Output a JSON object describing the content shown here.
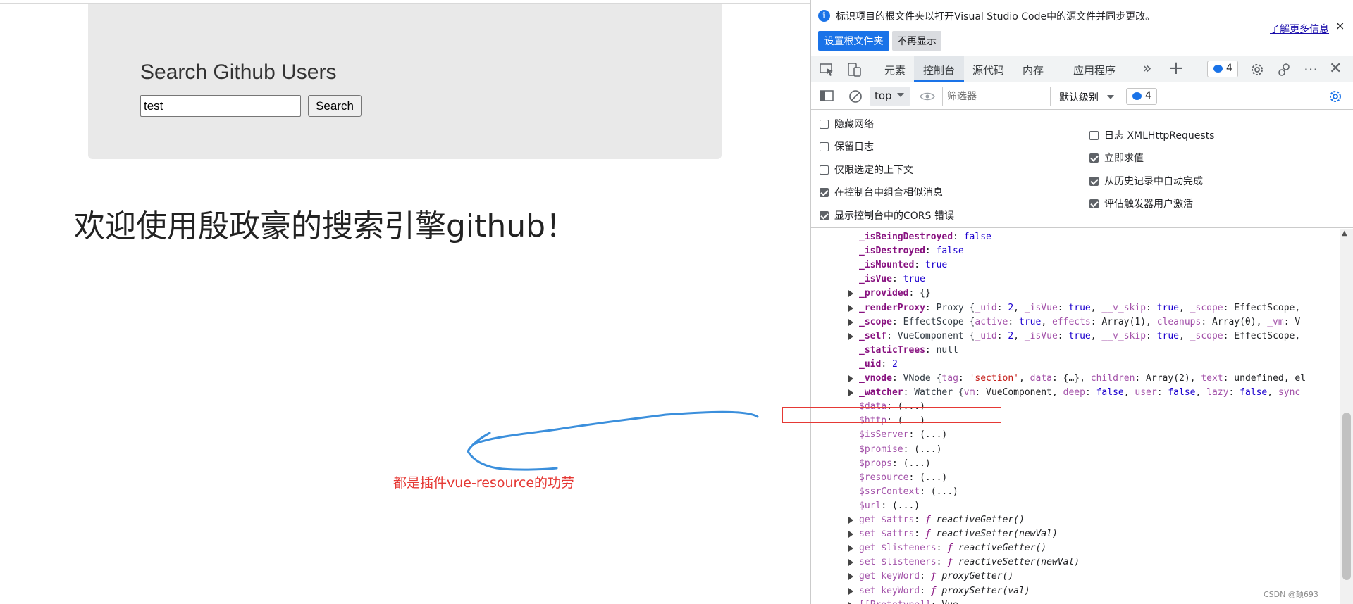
{
  "page": {
    "jumbotron_title": "Search Github Users",
    "search_value": "test",
    "search_button": "Search",
    "welcome": "欢迎使用殷政豪的搜索引擎github！",
    "annotation_note": "都是插件vue-resource的功劳"
  },
  "devtools": {
    "infobar": {
      "message": "标识项目的根文件夹以打开Visual Studio Code中的源文件并同步更改。",
      "learn_more": "了解更多信息",
      "close": "×",
      "set_root_button": "设置根文件夹",
      "dont_show_button": "不再显示"
    },
    "tabs": {
      "elements": "元素",
      "console": "控制台",
      "sources": "源代码",
      "memory": "内存",
      "application": "应用程序",
      "more": "»",
      "add": "+"
    },
    "issues_badge": "4",
    "filterbar": {
      "context": "top",
      "filter_placeholder": "筛选器",
      "level": "默认级别",
      "messages_badge": "4"
    },
    "settings": {
      "left": [
        {
          "label": "隐藏网络",
          "checked": false
        },
        {
          "label": "保留日志",
          "checked": false
        },
        {
          "label": "仅限选定的上下文",
          "checked": false
        },
        {
          "label": "在控制台中组合相似消息",
          "checked": true
        },
        {
          "label": "显示控制台中的CORS 错误",
          "checked": true
        }
      ],
      "right": [
        {
          "label": "日志 XMLHttpRequests",
          "checked": false
        },
        {
          "label": "立即求值",
          "checked": true
        },
        {
          "label": "从历史记录中自动完成",
          "checked": true
        },
        {
          "label": "评估触发器用户激活",
          "checked": true
        }
      ]
    },
    "console_lines": [
      {
        "expand": false,
        "key": "_isBeingDestroyed",
        "style": "kb",
        "rest": [
          [
            "pun",
            ": "
          ],
          [
            "n",
            "false"
          ]
        ]
      },
      {
        "expand": false,
        "key": "_isDestroyed",
        "style": "kb",
        "rest": [
          [
            "pun",
            ": "
          ],
          [
            "n",
            "false"
          ]
        ]
      },
      {
        "expand": false,
        "key": "_isMounted",
        "style": "kb",
        "rest": [
          [
            "pun",
            ": "
          ],
          [
            "n",
            "true"
          ]
        ]
      },
      {
        "expand": false,
        "key": "_isVue",
        "style": "kb",
        "rest": [
          [
            "pun",
            ": "
          ],
          [
            "n",
            "true"
          ]
        ]
      },
      {
        "expand": true,
        "key": "_provided",
        "style": "kb",
        "rest": [
          [
            "pun",
            ": {}"
          ]
        ]
      },
      {
        "expand": true,
        "key": "_renderProxy",
        "style": "kb",
        "rest": [
          [
            "pun",
            ": "
          ],
          [
            "cls",
            "Proxy {"
          ],
          [
            "kd",
            "_uid"
          ],
          [
            "pun",
            ": "
          ],
          [
            "n",
            "2"
          ],
          [
            "pun",
            ", "
          ],
          [
            "kd",
            "_isVue"
          ],
          [
            "pun",
            ": "
          ],
          [
            "n",
            "true"
          ],
          [
            "pun",
            ", "
          ],
          [
            "kd",
            "__v_skip"
          ],
          [
            "pun",
            ": "
          ],
          [
            "n",
            "true"
          ],
          [
            "pun",
            ", "
          ],
          [
            "kd",
            "_scope"
          ],
          [
            "pun",
            ": EffectScope, "
          ]
        ]
      },
      {
        "expand": true,
        "key": "_scope",
        "style": "kb",
        "rest": [
          [
            "pun",
            ": "
          ],
          [
            "cls",
            "EffectScope {"
          ],
          [
            "kd",
            "active"
          ],
          [
            "pun",
            ": "
          ],
          [
            "n",
            "true"
          ],
          [
            "pun",
            ", "
          ],
          [
            "kd",
            "effects"
          ],
          [
            "pun",
            ": Array(1), "
          ],
          [
            "kd",
            "cleanups"
          ],
          [
            "pun",
            ": Array(0), "
          ],
          [
            "kd",
            "_vm"
          ],
          [
            "pun",
            ": V"
          ]
        ]
      },
      {
        "expand": true,
        "key": "_self",
        "style": "kb",
        "rest": [
          [
            "pun",
            ": "
          ],
          [
            "cls",
            "VueComponent {"
          ],
          [
            "kd",
            "_uid"
          ],
          [
            "pun",
            ": "
          ],
          [
            "n",
            "2"
          ],
          [
            "pun",
            ", "
          ],
          [
            "kd",
            "_isVue"
          ],
          [
            "pun",
            ": "
          ],
          [
            "n",
            "true"
          ],
          [
            "pun",
            ", "
          ],
          [
            "kd",
            "__v_skip"
          ],
          [
            "pun",
            ": "
          ],
          [
            "n",
            "true"
          ],
          [
            "pun",
            ", "
          ],
          [
            "kd",
            "_scope"
          ],
          [
            "pun",
            ": EffectScope, "
          ]
        ]
      },
      {
        "expand": false,
        "key": "_staticTrees",
        "style": "kb",
        "rest": [
          [
            "pun",
            ": "
          ],
          [
            "cls",
            "null"
          ]
        ]
      },
      {
        "expand": false,
        "key": "_uid",
        "style": "kb",
        "rest": [
          [
            "pun",
            ": "
          ],
          [
            "n",
            "2"
          ]
        ]
      },
      {
        "expand": true,
        "key": "_vnode",
        "style": "kb",
        "rest": [
          [
            "pun",
            ": "
          ],
          [
            "cls",
            "VNode {"
          ],
          [
            "kd",
            "tag"
          ],
          [
            "pun",
            ": "
          ],
          [
            "s",
            "'section'"
          ],
          [
            "pun",
            ", "
          ],
          [
            "kd",
            "data"
          ],
          [
            "pun",
            ": {…}, "
          ],
          [
            "kd",
            "children"
          ],
          [
            "pun",
            ": Array(2), "
          ],
          [
            "kd",
            "text"
          ],
          [
            "pun",
            ": undefined, el"
          ]
        ]
      },
      {
        "expand": true,
        "key": "_watcher",
        "style": "kb",
        "rest": [
          [
            "pun",
            ": "
          ],
          [
            "cls",
            "Watcher {"
          ],
          [
            "kd",
            "vm"
          ],
          [
            "pun",
            ": VueComponent, "
          ],
          [
            "kd",
            "deep"
          ],
          [
            "pun",
            ": "
          ],
          [
            "n",
            "false"
          ],
          [
            "pun",
            ", "
          ],
          [
            "kd",
            "user"
          ],
          [
            "pun",
            ": "
          ],
          [
            "n",
            "false"
          ],
          [
            "pun",
            ", "
          ],
          [
            "kd",
            "lazy"
          ],
          [
            "pun",
            ": "
          ],
          [
            "n",
            "false"
          ],
          [
            "pun",
            ", "
          ],
          [
            "kd",
            "sync"
          ]
        ]
      },
      {
        "expand": false,
        "key": "$data",
        "style": "kd",
        "rest": [
          [
            "pun",
            ": (...)"
          ]
        ]
      },
      {
        "expand": false,
        "key": "$http",
        "style": "kd",
        "rest": [
          [
            "pun",
            ": (...)"
          ]
        ]
      },
      {
        "expand": false,
        "key": "$isServer",
        "style": "kd",
        "rest": [
          [
            "pun",
            ": (...)"
          ]
        ]
      },
      {
        "expand": false,
        "key": "$promise",
        "style": "kd",
        "rest": [
          [
            "pun",
            ": (...)"
          ]
        ]
      },
      {
        "expand": false,
        "key": "$props",
        "style": "kd",
        "rest": [
          [
            "pun",
            ": (...)"
          ]
        ]
      },
      {
        "expand": false,
        "key": "$resource",
        "style": "kd",
        "rest": [
          [
            "pun",
            ": (...)"
          ]
        ]
      },
      {
        "expand": false,
        "key": "$ssrContext",
        "style": "kd",
        "rest": [
          [
            "pun",
            ": (...)"
          ]
        ]
      },
      {
        "expand": false,
        "key": "$url",
        "style": "kd",
        "rest": [
          [
            "pun",
            ": (...)"
          ]
        ]
      },
      {
        "expand": true,
        "key": "get $attrs",
        "style": "kd",
        "rest": [
          [
            "pun",
            ": "
          ],
          [
            "fsym",
            "ƒ "
          ],
          [
            "fn-ital",
            "reactiveGetter()"
          ]
        ]
      },
      {
        "expand": true,
        "key": "set $attrs",
        "style": "kd",
        "rest": [
          [
            "pun",
            ": "
          ],
          [
            "fsym",
            "ƒ "
          ],
          [
            "fn-ital",
            "reactiveSetter(newVal)"
          ]
        ]
      },
      {
        "expand": true,
        "key": "get $listeners",
        "style": "kd",
        "rest": [
          [
            "pun",
            ": "
          ],
          [
            "fsym",
            "ƒ "
          ],
          [
            "fn-ital",
            "reactiveGetter()"
          ]
        ]
      },
      {
        "expand": true,
        "key": "set $listeners",
        "style": "kd",
        "rest": [
          [
            "pun",
            ": "
          ],
          [
            "fsym",
            "ƒ "
          ],
          [
            "fn-ital",
            "reactiveSetter(newVal)"
          ]
        ]
      },
      {
        "expand": true,
        "key": "get keyWord",
        "style": "kd",
        "rest": [
          [
            "pun",
            ": "
          ],
          [
            "fsym",
            "ƒ "
          ],
          [
            "fn-ital",
            "proxyGetter()"
          ]
        ]
      },
      {
        "expand": true,
        "key": "set keyWord",
        "style": "kd",
        "rest": [
          [
            "pun",
            ": "
          ],
          [
            "fsym",
            "ƒ "
          ],
          [
            "fn-ital",
            "proxySetter(val)"
          ]
        ]
      },
      {
        "expand": true,
        "key": "[[Prototype]]",
        "style": "kd",
        "rest": [
          [
            "pun",
            ": Vue"
          ]
        ]
      }
    ],
    "watermark": "CSDN @颉693"
  },
  "colors": {
    "accent": "#1a73e8",
    "annotation_red": "#e53935",
    "arrow_blue": "#3b8fdc"
  }
}
